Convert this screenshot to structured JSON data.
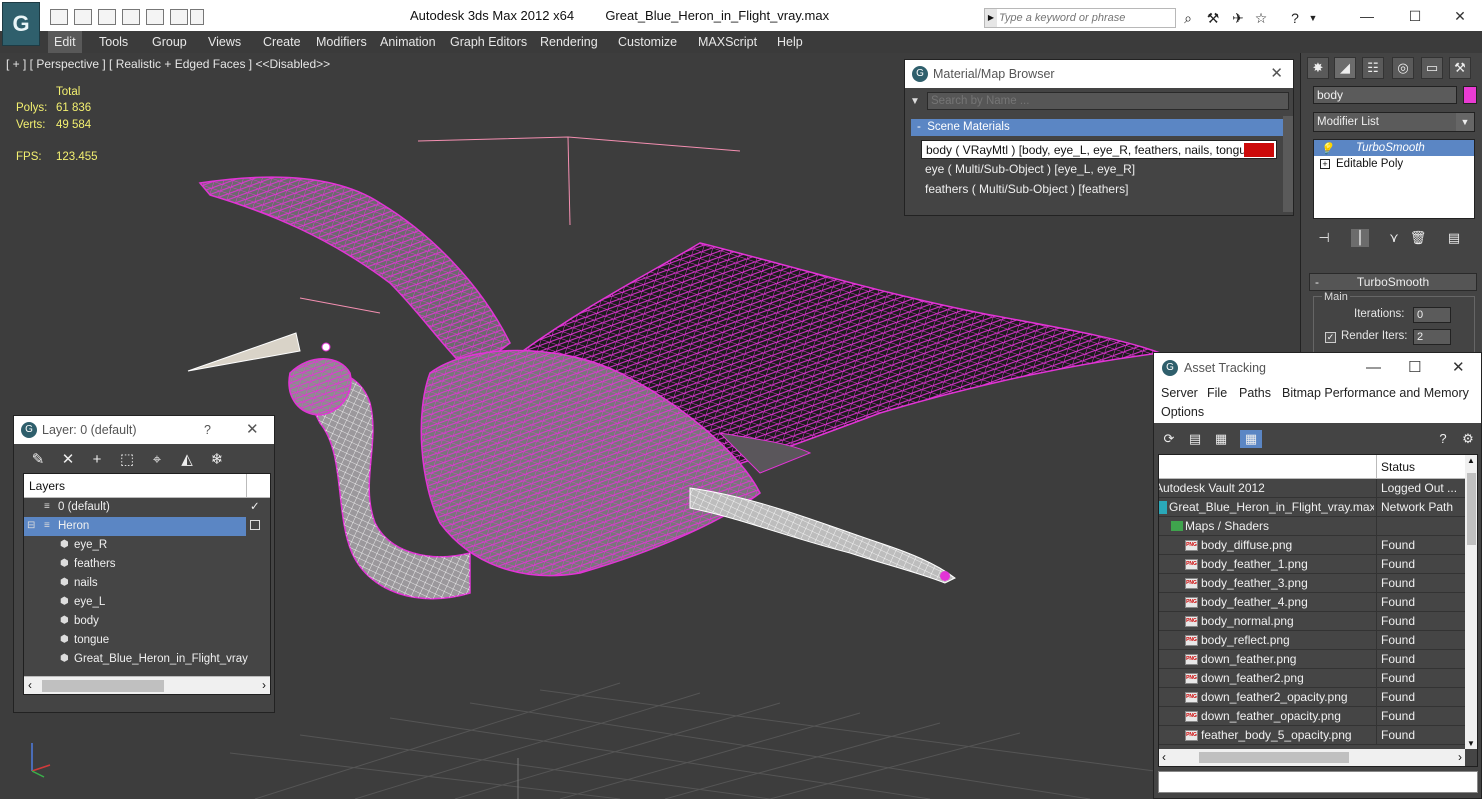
{
  "app": {
    "title_main": "Autodesk 3ds Max  2012 x64",
    "title_file": "Great_Blue_Heron_in_Flight_vray.max",
    "search_placeholder": "Type a keyword or phrase"
  },
  "menu": [
    "Edit",
    "Tools",
    "Group",
    "Views",
    "Create",
    "Modifiers",
    "Animation",
    "Graph Editors",
    "Rendering",
    "Customize",
    "MAXScript",
    "Help"
  ],
  "viewport": {
    "label": "[ + ] [ Perspective ] [ Realistic + Edged Faces ] <<Disabled>>",
    "stats_header": "Total",
    "polys_label": "Polys:",
    "polys_value": "61 836",
    "verts_label": "Verts:",
    "verts_value": "49 584",
    "fps_label": "FPS:",
    "fps_value": "123.455",
    "wire_color": "#e234d6"
  },
  "command_panel": {
    "object_name": "body",
    "object_color": "#e93bd3",
    "modifier_list": "Modifier List",
    "stack": [
      "TurboSmooth",
      "Editable Poly"
    ],
    "rollout_title": "TurboSmooth",
    "group_main": "Main",
    "iterations_label": "Iterations:",
    "iterations_value": "0",
    "render_iters_label": "Render Iters:",
    "render_iters_value": "2"
  },
  "material_browser": {
    "title": "Material/Map Browser",
    "search_placeholder": "Search by Name ...",
    "group": "Scene Materials",
    "rows": [
      "body  ( VRayMtl ) [body, eye_L, eye_R, feathers, nails, tongue]",
      "eye  ( Multi/Sub-Object ) [eye_L, eye_R]",
      "feathers  ( Multi/Sub-Object ) [feathers]"
    ]
  },
  "layer_dialog": {
    "title": "Layer: 0 (default)",
    "help": "?",
    "column": "Layers",
    "rows": [
      "0 (default)",
      "Heron",
      "eye_R",
      "feathers",
      "nails",
      "eye_L",
      "body",
      "tongue",
      "Great_Blue_Heron_in_Flight_vray"
    ]
  },
  "asset_tracking": {
    "title": "Asset Tracking",
    "menu": [
      "Server",
      "File",
      "Paths",
      "Bitmap Performance and Memory",
      "Options"
    ],
    "status_header": "Status",
    "rows": [
      {
        "name": "Autodesk Vault 2012",
        "status": "Logged Out ..."
      },
      {
        "name": "Great_Blue_Heron_in_Flight_vray.max",
        "status": "Network Path"
      },
      {
        "name": "Maps / Shaders",
        "status": ""
      },
      {
        "name": "body_diffuse.png",
        "status": "Found"
      },
      {
        "name": "body_feather_1.png",
        "status": "Found"
      },
      {
        "name": "body_feather_3.png",
        "status": "Found"
      },
      {
        "name": "body_feather_4.png",
        "status": "Found"
      },
      {
        "name": "body_normal.png",
        "status": "Found"
      },
      {
        "name": "body_reflect.png",
        "status": "Found"
      },
      {
        "name": "down_feather.png",
        "status": "Found"
      },
      {
        "name": "down_feather2.png",
        "status": "Found"
      },
      {
        "name": "down_feather2_opacity.png",
        "status": "Found"
      },
      {
        "name": "down_feather_opacity.png",
        "status": "Found"
      },
      {
        "name": "feather_body_5_opacity.png",
        "status": "Found"
      }
    ]
  }
}
